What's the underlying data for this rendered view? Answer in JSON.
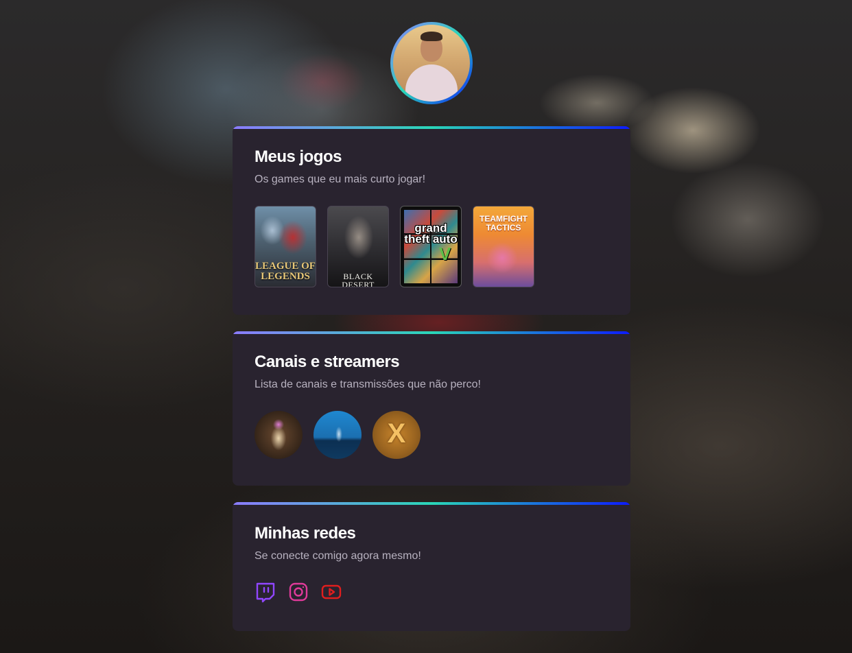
{
  "profile": {
    "avatar_alt": "Foto de perfil"
  },
  "games_section": {
    "title": "Meus jogos",
    "subtitle": "Os games que eu mais curto jogar!",
    "games": [
      {
        "name": "League of Legends",
        "cover_text": "LEAGUE OF LEGENDS"
      },
      {
        "name": "Black Desert",
        "cover_text": "BLACK DESERT"
      },
      {
        "name": "Grand Theft Auto V",
        "cover_text": "grand theft auto"
      },
      {
        "name": "Teamfight Tactics",
        "cover_text": "TEAMFIGHT TACTICS"
      }
    ]
  },
  "channels_section": {
    "title": "Canais e streamers",
    "subtitle": "Lista de canais e transmissões que não perco!",
    "channels": [
      {
        "icon": "streamer-avatar-1"
      },
      {
        "icon": "streamer-avatar-2"
      },
      {
        "icon": "streamer-avatar-3",
        "mark": "X"
      }
    ]
  },
  "social_section": {
    "title": "Minhas redes",
    "subtitle": "Se conecte comigo agora mesmo!",
    "links": [
      {
        "network": "Twitch",
        "icon": "twitch-icon",
        "color": "#9146ff"
      },
      {
        "network": "Instagram",
        "icon": "instagram-icon",
        "color": "#e1306c"
      },
      {
        "network": "YouTube",
        "icon": "youtube-icon",
        "color": "#e01e1e"
      }
    ]
  },
  "colors": {
    "card_background": "#29232f",
    "gradient_start": "#8c7bff",
    "gradient_middle": "#2ad6b8",
    "gradient_end": "#0d1bff",
    "subtitle_text": "#b8b2c0"
  }
}
